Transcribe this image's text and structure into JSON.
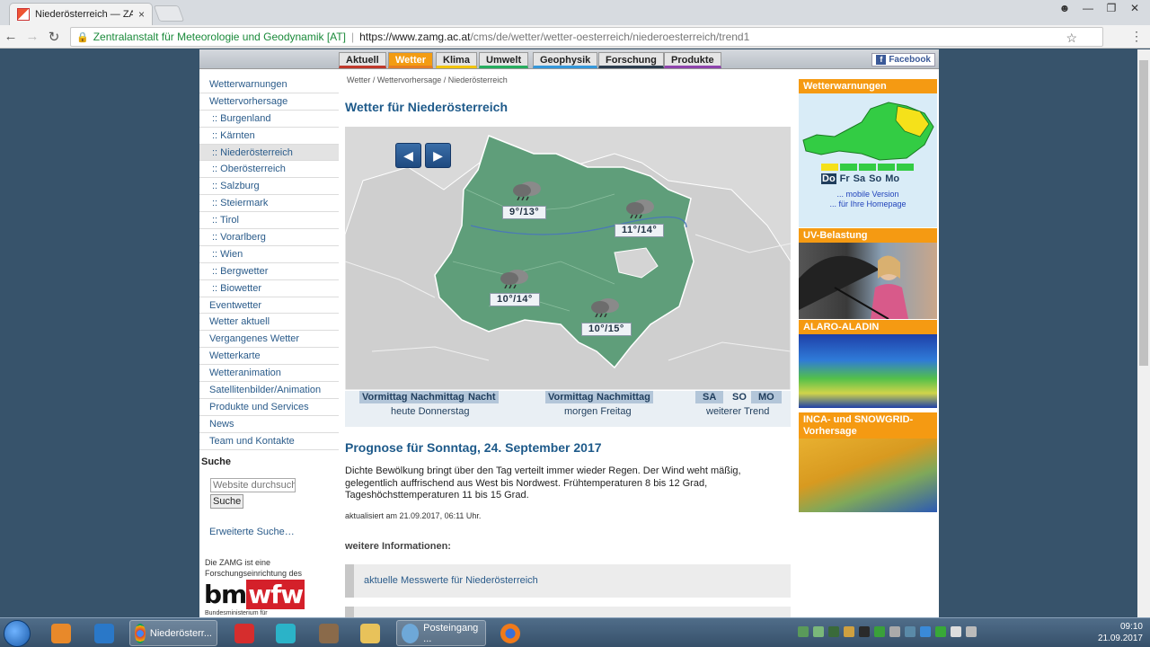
{
  "browser": {
    "tab_title": "Niederösterreich — ZAMG",
    "tab_close": "×",
    "secure_label": "Zentralanstalt für Meteorologie und Geodynamik [AT]",
    "url_base": "https://www.zamg.ac.at",
    "url_path": "/cms/de/wetter/wetter-oesterreich/niederoesterreich/trend1"
  },
  "topnav": {
    "items": [
      "Aktuell",
      "Wetter",
      "Klima",
      "Umwelt",
      "Geophysik",
      "Forschung",
      "Produkte"
    ],
    "facebook": "Facebook"
  },
  "leftnav": {
    "items": [
      "Wetterwarnungen",
      "Wettervorhersage",
      ":: Burgenland",
      ":: Kärnten",
      ":: Niederösterreich",
      ":: Oberösterreich",
      ":: Salzburg",
      ":: Steiermark",
      ":: Tirol",
      ":: Vorarlberg",
      ":: Wien",
      ":: Bergwetter",
      ":: Biowetter",
      "Eventwetter",
      "Wetter aktuell",
      "Vergangenes Wetter",
      "Wetterkarte",
      "Wetteranimation",
      "Satellitenbilder/Animation",
      "Produkte und Services",
      "News",
      "Team und Kontakte"
    ],
    "search_title": "Suche",
    "search_placeholder": "Website durchsuchen",
    "search_button": "Suche",
    "advanced_search": "Erweiterte Suche…",
    "zamg_note": "Die ZAMG ist eine Forschungseinrichtung des",
    "bm_logo_1": "bm",
    "bm_logo_2": "wfw",
    "bm_sub": "Bundesministerium für"
  },
  "main": {
    "breadcrumb": "Wetter / Wettervorhersage / Niederösterreich",
    "heading": "Wetter für Niederösterreich",
    "map_labels": [
      "9°/13°",
      "11°/14°",
      "10°/14°",
      "10°/15°"
    ],
    "tabs": {
      "today": [
        "Vormittag",
        "Nachmittag",
        "Nacht"
      ],
      "today_caption": "heute Donnerstag",
      "tomorrow": [
        "Vormittag",
        "Nachmittag"
      ],
      "tomorrow_caption": "morgen Freitag",
      "trend": [
        "SA",
        "SO",
        "MO"
      ],
      "trend_caption": "weiterer Trend"
    },
    "forecast_title": "Prognose für Sonntag, 24. September 2017",
    "forecast_text": "Dichte Bewölkung bringt über den Tag verteilt immer wieder Regen. Der Wind weht mäßig, gelegentlich auffrischend aus West bis Nordwest. Frühtemperaturen 8 bis 12 Grad, Tageshöchsttemperaturen 11 bis 15 Grad.",
    "updated": "aktualisiert am 21.09.2017, 06:11 Uhr.",
    "more_info": "weitere Informationen:",
    "link1": "aktuelle Messwerte für Niederösterreich"
  },
  "right": {
    "warn_title": "Wetterwarnungen",
    "warn_days": [
      "Do",
      "Fr",
      "Sa",
      "So",
      "Mo"
    ],
    "mobile": "... mobile Version",
    "homepage": "... für Ihre Homepage",
    "uv_title": "UV-Belastung",
    "alaro_title": "ALARO-ALADIN",
    "inca_title": "INCA- und SNOWGRID-Vorhersage"
  },
  "taskbar": {
    "chrome_label": "Niederösterr...",
    "mail_label": "Posteingang ...",
    "time": "09:10",
    "date": "21.09.2017"
  }
}
